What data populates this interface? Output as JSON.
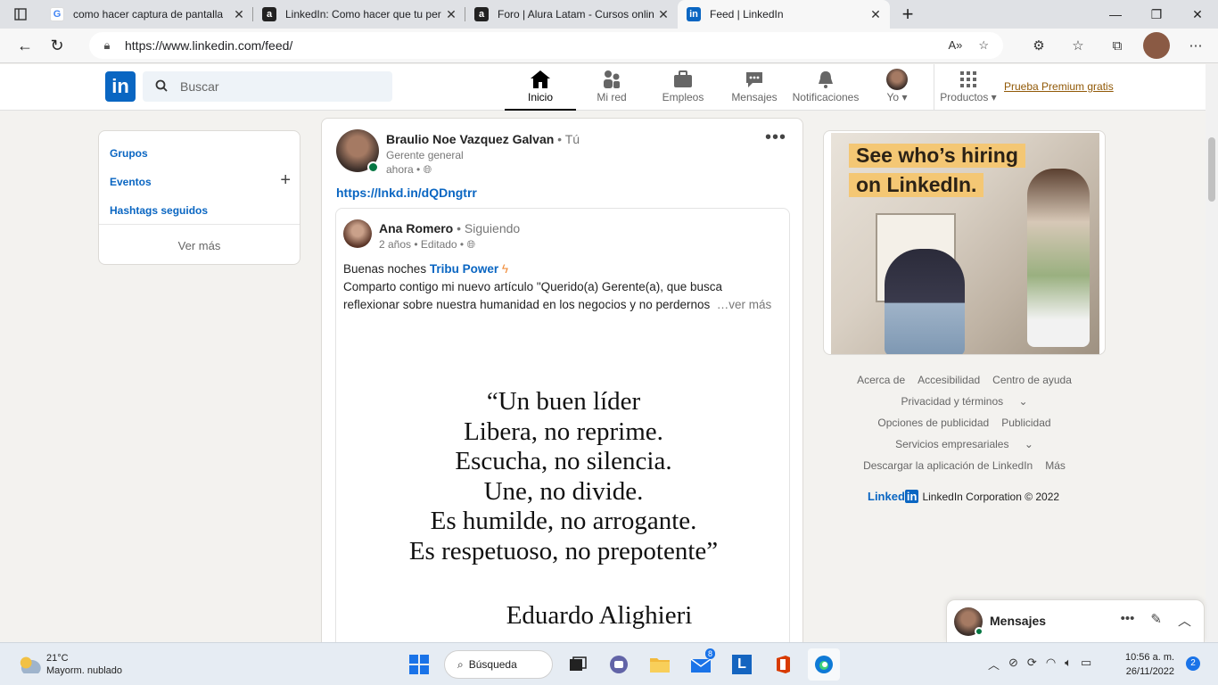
{
  "browser": {
    "tabs": [
      {
        "title": "como hacer captura de pantalla",
        "favicon": "google-icon"
      },
      {
        "title": "LinkedIn: Como hacer que tu per",
        "favicon": "alura-icon"
      },
      {
        "title": "Foro | Alura Latam - Cursos onlin",
        "favicon": "alura-icon"
      },
      {
        "title": "Feed | LinkedIn",
        "favicon": "linkedin-icon"
      }
    ],
    "url": "https://www.linkedin.com/feed/"
  },
  "linkedin": {
    "logo": "in",
    "search_placeholder": "Buscar",
    "nav": [
      {
        "label": "Inicio",
        "icon": "home-icon"
      },
      {
        "label": "Mi red",
        "icon": "network-icon"
      },
      {
        "label": "Empleos",
        "icon": "briefcase-icon"
      },
      {
        "label": "Mensajes",
        "icon": "messaging-icon"
      },
      {
        "label": "Notificaciones",
        "icon": "bell-icon"
      },
      {
        "label": "Yo",
        "icon": "avatar"
      },
      {
        "label": "Productos",
        "icon": "grid-icon"
      }
    ],
    "premium": "Prueba Premium gratis",
    "accent": "#0a66c2"
  },
  "sidebar": {
    "links": [
      "Grupos",
      "Eventos",
      "Hashtags seguidos"
    ],
    "more": "Ver más"
  },
  "post": {
    "author": "Braulio Noe Vazquez Galvan",
    "author_suffix": "• Tú",
    "headline": "Gerente general",
    "time": "ahora •",
    "link": "https://lnkd.in/dQDngtrr",
    "shared": {
      "author": "Ana Romero",
      "author_suffix": "• Siguiendo",
      "time": "2 años • Editado •",
      "text_prefix": "Buenas noches ",
      "tag": "Tribu Power",
      "text_line2": "Comparto contigo mi nuevo artículo \"Querido(a) Gerente(a), que busca",
      "text_line3": "reflexionar sobre nuestra humanidad en los negocios y no perdernos",
      "see_more": "…ver más",
      "quote_lines": [
        "“Un buen líder",
        "Libera, no reprime.",
        "Escucha, no silencia.",
        "Une, no divide.",
        "Es humilde, no arrogante.",
        "Es respetuoso, no prepotente”"
      ],
      "quote_author": "Eduardo Alighieri"
    }
  },
  "ad": {
    "line1": "See who’s hiring",
    "line2": "on LinkedIn."
  },
  "footer": {
    "row1": [
      "Acerca de",
      "Accesibilidad",
      "Centro de ayuda"
    ],
    "row2": [
      "Privacidad y términos"
    ],
    "row3": [
      "Opciones de publicidad",
      "Publicidad"
    ],
    "row4": [
      "Servicios empresariales"
    ],
    "row5": [
      "Descargar la aplicación de LinkedIn",
      "Más"
    ],
    "brand": "Linked",
    "brand_in": "in",
    "copyright": "LinkedIn Corporation © 2022"
  },
  "messaging": {
    "title": "Mensajes"
  },
  "taskbar": {
    "temp": "21°C",
    "weather": "Mayorm. nublado",
    "search": "Búsqueda",
    "mail_badge": "8",
    "time": "10:56 a. m.",
    "date": "26/11/2022",
    "notifications": "2"
  }
}
